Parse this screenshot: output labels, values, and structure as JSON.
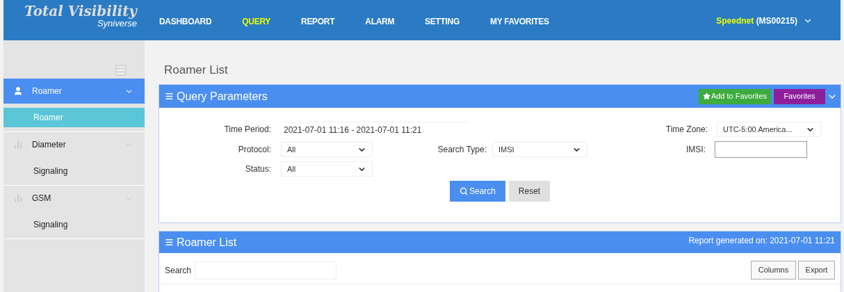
{
  "header": {
    "logo_title": "Total Visibility",
    "logo_subtitle": "Syniverse",
    "nav": [
      {
        "label": "DASHBOARD",
        "selected": false
      },
      {
        "label": "QUERY",
        "selected": true
      },
      {
        "label": "REPORT",
        "selected": false
      },
      {
        "label": "ALARM",
        "selected": false
      },
      {
        "label": "SETTING",
        "selected": false
      },
      {
        "label": "MY FAVORITES",
        "selected": false
      }
    ],
    "user": {
      "name": "Speednet",
      "account": "(MS00215)"
    }
  },
  "sidebar": {
    "groups": [
      {
        "label": "Roamer",
        "kind": "user",
        "expanded": true,
        "children": [
          {
            "label": "Roamer",
            "selected": true
          }
        ]
      },
      {
        "label": "Diameter",
        "kind": "signal",
        "expanded": false,
        "children": [
          {
            "label": "Signaling",
            "selected": false
          }
        ]
      },
      {
        "label": "GSM",
        "kind": "signal",
        "expanded": false,
        "children": [
          {
            "label": "Signaling",
            "selected": false
          }
        ]
      }
    ]
  },
  "page_title": "Roamer List",
  "query_panel": {
    "title": "Query Parameters",
    "add_favorites": "Add to Favorites",
    "favorites": "Favorites",
    "time_period": {
      "label": "Time Period:",
      "value": "2021-07-01 11:16 - 2021-07-01 11:21"
    },
    "time_zone": {
      "label": "Time Zone:",
      "value": "UTC-5:00 America..."
    },
    "protocol": {
      "label": "Protocol:",
      "value": "All"
    },
    "search_type": {
      "label": "Search Type:",
      "value": "IMSI"
    },
    "imsi": {
      "label": "IMSI:"
    },
    "status": {
      "label": "Status:",
      "value": "All"
    },
    "search_button": "Search",
    "reset_button": "Reset"
  },
  "list_panel": {
    "title": "Roamer List",
    "generated": "Report generated on: 2021-07-01 11:21",
    "search_label": "Search",
    "columns_button": "Columns",
    "export_button": "Export"
  }
}
